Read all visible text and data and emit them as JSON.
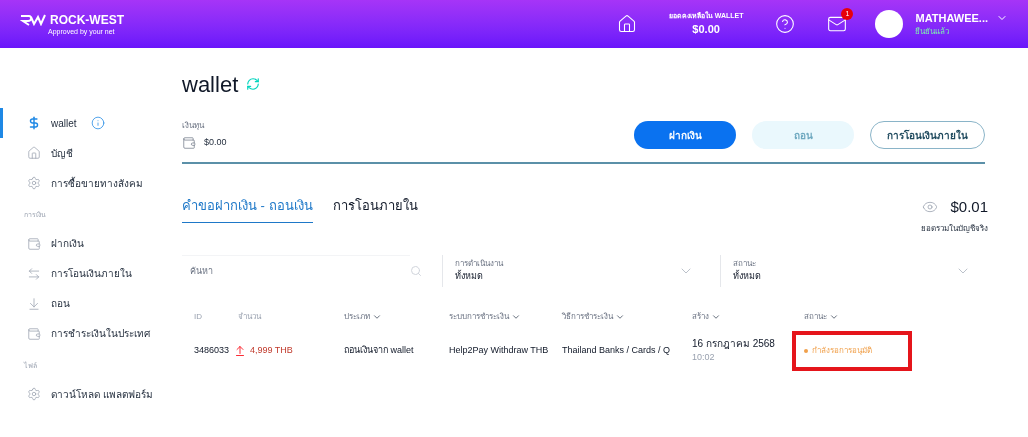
{
  "header": {
    "logo": "ROCK-WEST",
    "tagline": "Approved by your net",
    "balance_label": "ยอดคงเหลือใน WALLET",
    "balance": "$0.00",
    "unread": "1",
    "user_name": "MATHAWEE...",
    "user_status": "ยืนยันแล้ว"
  },
  "sidebar": {
    "sections": [
      {
        "items": [
          {
            "label": "wallet",
            "selected": true
          },
          {
            "label": "บัญชี",
            "selected": false
          },
          {
            "label": "การซื้อขายทางสังคม",
            "selected": false
          }
        ]
      },
      {
        "title": "การเงิน",
        "items": [
          {
            "label": "ฝากเงิน",
            "selected": false
          },
          {
            "label": "การโอนเงินภายใน",
            "selected": false
          },
          {
            "label": "ถอน",
            "selected": false
          },
          {
            "label": "การชำระเงินในประเทศ",
            "selected": false
          }
        ]
      },
      {
        "title": "ไฟล์",
        "items": [
          {
            "label": "ดาวน์โหลด แพลตฟอร์ม",
            "selected": false
          }
        ]
      }
    ]
  },
  "page": {
    "title": "wallet",
    "funds_label": "เงินทุน",
    "funds": "$0.00",
    "buttons": [
      {
        "label": "ฝากเงิน",
        "kind": "primary",
        "disabled": false
      },
      {
        "label": "ถอน",
        "kind": "primary",
        "disabled": true
      },
      {
        "label": "การโอนเงินภายใน",
        "kind": "outline",
        "disabled": false
      }
    ],
    "tabs": [
      {
        "label": "คำขอฝากเงิน - ถอนเงิน",
        "selected": true
      },
      {
        "label": "การโอนภายใน",
        "selected": false
      }
    ],
    "total": "$0.01",
    "total_label": "ยอดรวมในบัญชีจริง",
    "search": {
      "placeholder": "ค้นหา"
    },
    "filters": [
      {
        "label": "การดำเนินงาน",
        "value": "ทั้งหมด"
      },
      {
        "label": "สถานะ",
        "value": "ทั้งหมด"
      }
    ],
    "table": {
      "columns": [
        {
          "label": "ID",
          "sortable": false
        },
        {
          "label": "จำนวน",
          "sortable": false
        },
        {
          "label": "ประเภท",
          "sortable": true
        },
        {
          "label": "ระบบการชำระเงิน",
          "sortable": true
        },
        {
          "label": "วิธีการชำระเงิน",
          "sortable": true
        },
        {
          "label": "สร้าง",
          "sortable": true
        },
        {
          "label": "สถานะ",
          "sortable": true
        }
      ],
      "rows": [
        {
          "id": "3486033",
          "amount": "4,999 THB",
          "type": "ถอนเงินจาก wallet",
          "system": "Help2Pay Withdraw THB",
          "method": "Thailand Banks / Cards / Q",
          "date": "16 กรกฎาคม 2568",
          "time": "10:02",
          "status": "กำลังรอการอนุมัติ",
          "color": "#f0a04b",
          "highlighted": true
        }
      ]
    }
  }
}
